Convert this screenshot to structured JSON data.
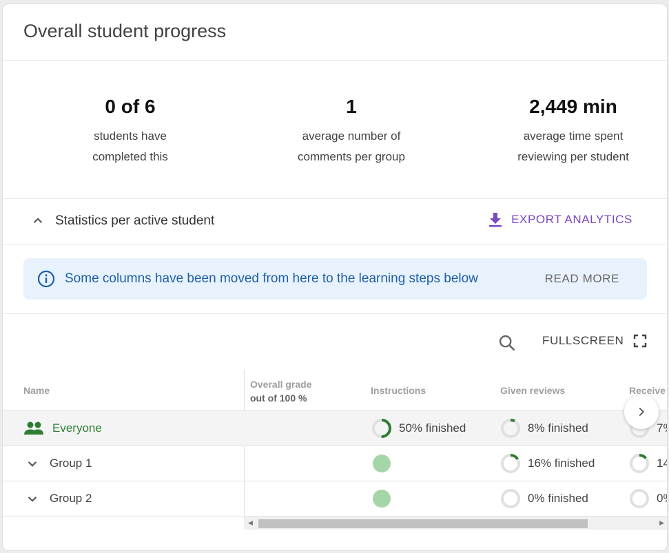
{
  "title": "Overall student progress",
  "stats": [
    {
      "value": "0 of 6",
      "line1": "students have",
      "line2": "completed this"
    },
    {
      "value": "1",
      "line1": "average number of",
      "line2": "comments per group"
    },
    {
      "value": "2,449 min",
      "line1": "average time spent",
      "line2": "reviewing per student"
    }
  ],
  "section": {
    "title": "Statistics per active student",
    "export_label": "EXPORT ANALYTICS"
  },
  "banner": {
    "text": "Some columns have been moved from here to the learning steps below",
    "action": "READ MORE"
  },
  "toolbar": {
    "fullscreen_label": "FULLSCREEN"
  },
  "columns": {
    "name": "Name",
    "grade": "Overall grade",
    "grade_sub": "out of 100 %",
    "instructions": "Instructions",
    "given": "Given reviews",
    "received": "Receive"
  },
  "rows": [
    {
      "name": "Everyone",
      "instructions": "50% finished",
      "instructions_progress": 0.5,
      "given": "8% finished",
      "given_progress": 0.08,
      "received": "7%",
      "received_progress": 0.07
    },
    {
      "name": "Group 1",
      "instructions": "",
      "instructions_progress": 1,
      "given": "16% finished",
      "given_progress": 0.16,
      "received": "14",
      "received_progress": 0.14
    },
    {
      "name": "Group 2",
      "instructions": "",
      "instructions_progress": 1,
      "given": "0% finished",
      "given_progress": 0,
      "received": "0%",
      "received_progress": 0
    }
  ],
  "colors": {
    "accent": "#7b47c2",
    "success": "#2e7d32",
    "info": "#1e5fa8",
    "info_bg": "#e8f2fc"
  }
}
